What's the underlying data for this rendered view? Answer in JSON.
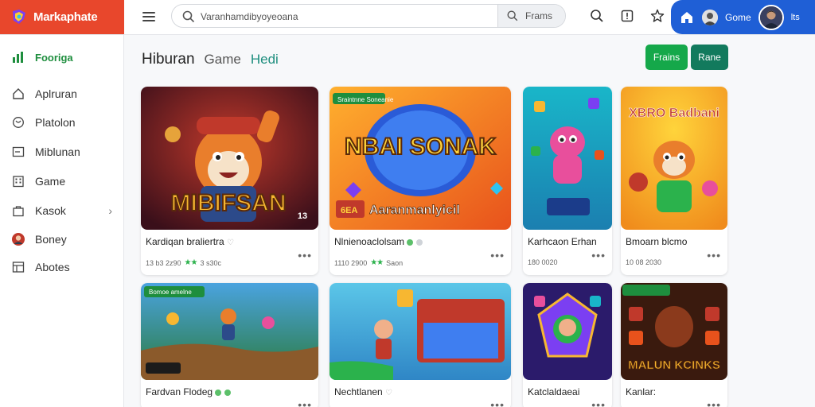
{
  "brand": {
    "name": "Markaphate",
    "color": "#e8472c"
  },
  "search": {
    "value": "Varanhamdibyoyeoana",
    "clear": "×",
    "button_label": "Frams"
  },
  "account": {
    "name": "Gome",
    "more": "lts",
    "accent": "#1f5fd6"
  },
  "sidebar": {
    "items": [
      {
        "label": "Fooriga",
        "icon": "chart-icon",
        "active": true
      },
      {
        "label": "Aplruran",
        "icon": "home-icon"
      },
      {
        "label": "Platolon",
        "icon": "globe-icon"
      },
      {
        "label": "Miblunan",
        "icon": "window-icon"
      },
      {
        "label": "Game",
        "icon": "building-icon"
      },
      {
        "label": "Kasok",
        "icon": "bag-icon",
        "chevron": "›"
      },
      {
        "label": "Boney",
        "icon": "avatar-icon"
      },
      {
        "label": "Abotes",
        "icon": "grid-icon"
      }
    ]
  },
  "header": {
    "title": "Hiburan",
    "tabs": [
      "Game",
      "Hedi"
    ],
    "btn_primary": "Frains",
    "btn_secondary": "Rane",
    "green": "#15a84a",
    "teal": "#127a5d"
  },
  "cards": [
    {
      "title": "Kardiqan braliertra",
      "meta": "13 b3 2z90",
      "stars": "★★",
      "meta2": "3 s30c",
      "art_text": "MIBIFSAN",
      "art_badge": "13"
    },
    {
      "title": "Nlnienoaclolsam",
      "meta": "1110 2900",
      "stars": "★★",
      "meta2": "Saon",
      "art_text": "NBAI SONAK",
      "art_tag": "Sraintnne Soneanie",
      "art_banner": "Aaranmanlyicil",
      "art_banner_tag": "6EA"
    },
    {
      "title": "Karhcaon Erhan",
      "meta": "180 0020",
      "art_text": ""
    },
    {
      "title": "Bmoarn blcmo",
      "meta": "10 08 2030",
      "art_text": "XBRO Badbani"
    },
    {
      "title": "Fardvan Flodeg",
      "meta": "",
      "art_tag": "Bomoe amelne"
    },
    {
      "title": "Nechtlanen",
      "meta": "",
      "art_text": ""
    },
    {
      "title": "Katclaldaeai",
      "meta": "",
      "art_text": ""
    },
    {
      "title": "Kanlar:",
      "meta": "",
      "art_text": "MALUN KCINKS"
    }
  ]
}
